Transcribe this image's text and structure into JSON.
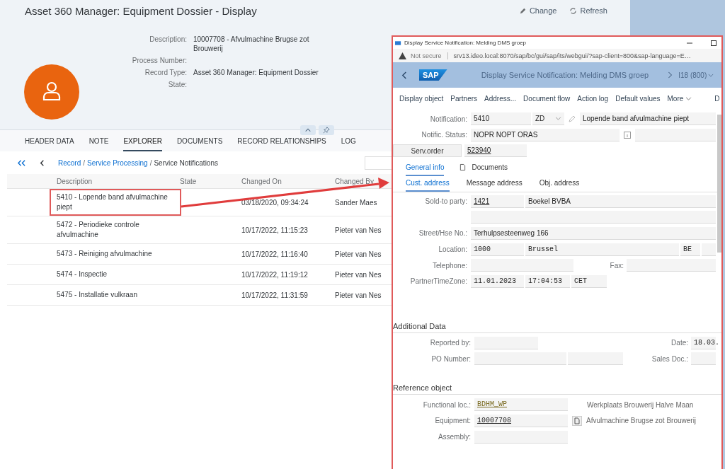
{
  "page": {
    "title": "Asset 360 Manager: Equipment Dossier - Display",
    "actions": [
      {
        "label": "Change",
        "kind": "edit"
      },
      {
        "label": "Refresh",
        "kind": "reload"
      }
    ],
    "header_fields": [
      {
        "label": "Description:",
        "value": "10007708 - Afvulmachine Brugse zot Brouwerij"
      },
      {
        "label": "Process Number:"
      },
      {
        "label": "Record Type:",
        "value": "Asset 360 Manager: Equipment Dossier"
      },
      {
        "label": "State:"
      }
    ],
    "tabs": [
      {
        "label": "HEADER DATA",
        "selected": false
      },
      {
        "label": "NOTE",
        "selected": false
      },
      {
        "label": "EXPLORER",
        "selected": true
      },
      {
        "label": "DOCUMENTS",
        "selected": false
      },
      {
        "label": "RECORD RELATIONSHIPS",
        "selected": false
      },
      {
        "label": "LOG",
        "selected": false
      }
    ],
    "breadcrumb": [
      {
        "label": "Record",
        "kind": "link"
      },
      {
        "label": "/",
        "kind": "separator"
      },
      {
        "label": "Service Processing",
        "kind": "link"
      },
      {
        "label": "/",
        "kind": "separator"
      },
      {
        "label": "Service Notifications",
        "kind": "current"
      }
    ],
    "table": {
      "columns": [
        "Description",
        "State",
        "Changed On",
        "Changed By"
      ],
      "rows": [
        {
          "description": "5410 - Lopende band afvulmachine piept",
          "changed_on": "03/18/2020, 09:34:24",
          "changed_by": "Sander Maes",
          "highlighted": true
        },
        {
          "description": "5472 - Periodieke controle afvulmachine",
          "changed_on": "10/17/2022, 11:15:23",
          "changed_by": "Pieter van Nes",
          "highlighted": false
        },
        {
          "description": "5473 - Reiniging afvulmachine",
          "changed_on": "10/17/2022, 11:16:40",
          "changed_by": "Pieter van Nes",
          "highlighted": false
        },
        {
          "description": "5474 - Inspectie",
          "changed_on": "10/17/2022, 11:19:12",
          "changed_by": "Pieter van Nes",
          "highlighted": false
        },
        {
          "description": "5475 - Installatie vulkraan",
          "changed_on": "10/17/2022, 11:31:59",
          "changed_by": "Pieter van Nes",
          "highlighted": false
        }
      ]
    }
  },
  "popup": {
    "window_title": "Display Service Notification: Melding DMS groep",
    "address": {
      "security": "Not secure",
      "url": "srv13.ideo.local:8070/sap/bc/gui/sap/its/webgui/?sap-client=800&sap-language=E…"
    },
    "shell": {
      "logo": "SAP",
      "title": "Display Service Notification: Melding DMS groep",
      "system": "I18 (800)"
    },
    "toolbar": [
      {
        "label": "Display object",
        "menu": false
      },
      {
        "label": "Partners",
        "menu": false
      },
      {
        "label": "Address...",
        "menu": false
      },
      {
        "label": "Document flow",
        "menu": false
      },
      {
        "label": "Action log",
        "menu": false
      },
      {
        "label": "Default values",
        "menu": false
      },
      {
        "label": "More",
        "menu": true
      },
      {
        "label": "D",
        "menu": false
      }
    ],
    "notification": {
      "label": "Notification:",
      "number": "5410",
      "type": "ZD",
      "text": "Lopende band afvulmachine piept"
    },
    "status": {
      "label": "Notific. Status:",
      "value": "NOPR NOPT ORAS"
    },
    "serv_order": {
      "label": "Serv.order",
      "value": "523940"
    },
    "tabs": [
      {
        "label": "General info",
        "selected": true
      },
      {
        "label": "Documents",
        "selected": false
      }
    ],
    "subtabs": [
      {
        "label": "Cust. address",
        "selected": true
      },
      {
        "label": "Message address",
        "selected": false
      },
      {
        "label": "Obj. address",
        "selected": false
      }
    ],
    "sold_to": {
      "label": "Sold-to party:",
      "number": "1421",
      "name": "Boekel BVBA"
    },
    "street": {
      "label": "Street/Hse No.:",
      "value": "Terhulpsesteenweg 166"
    },
    "location": {
      "label": "Location:",
      "postal": "1000",
      "city": "Brussel",
      "country": "BE"
    },
    "telephone": {
      "label": "Telephone:"
    },
    "fax": {
      "label": "Fax:"
    },
    "timezone": {
      "label": "PartnerTimeZone:",
      "date": "11.01.2023",
      "time": "17:04:53",
      "zone": "CET"
    },
    "additional": {
      "title": "Additional Data",
      "reported_by": "Reported by:",
      "date_label": "Date:",
      "date": "18.03.",
      "po": "PO Number:",
      "sales_doc": "Sales Doc.:"
    },
    "reference": {
      "title": "Reference object",
      "functional_loc": {
        "label": "Functional loc.:",
        "value": "BDHM_WP",
        "description": "Werkplaats Brouwerij Halve Maan"
      },
      "equipment": {
        "label": "Equipment:",
        "value": "10007708",
        "description": "Afvulmachine Brugse zot Brouwerij"
      },
      "assembly": {
        "label": "Assembly:"
      }
    }
  }
}
